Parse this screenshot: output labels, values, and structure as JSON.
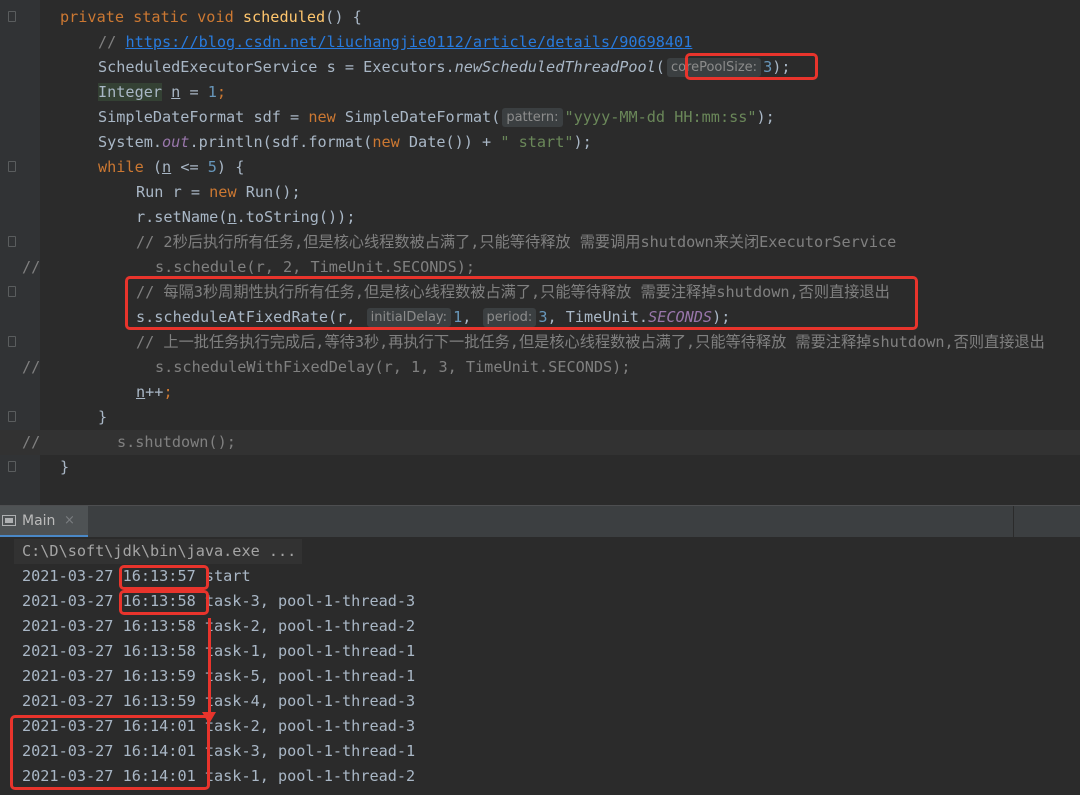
{
  "editor": {
    "lines": [
      {
        "segs": [
          [
            "kw",
            "private static void "
          ],
          [
            "fn",
            "scheduled"
          ],
          [
            "def",
            "() {"
          ]
        ]
      },
      {
        "segs": [
          [
            "cm",
            "// "
          ],
          [
            "url",
            "https://blog.csdn.net/liuchangjie0112/article/details/90698401"
          ]
        ]
      },
      {
        "segs": [
          [
            "def",
            "ScheduledExecutorService s = Executors."
          ],
          [
            "def it",
            "newScheduledThreadPool"
          ],
          [
            "def",
            "("
          ],
          [
            "hint",
            "corePoolSize:"
          ],
          [
            "num",
            "3"
          ],
          [
            "def",
            ");"
          ]
        ]
      },
      {
        "segs": [
          [
            "def hlk",
            "Integer"
          ],
          [
            "def",
            " "
          ],
          [
            "var",
            "n"
          ],
          [
            "def",
            " = "
          ],
          [
            "num",
            "1"
          ],
          [
            "kw",
            ";"
          ]
        ]
      },
      {
        "segs": [
          [
            "def",
            "SimpleDateFormat sdf = "
          ],
          [
            "kw",
            "new "
          ],
          [
            "def",
            "SimpleDateFormat("
          ],
          [
            "hint",
            "pattern:"
          ],
          [
            "str",
            "\"yyyy-MM-dd HH:mm:ss\""
          ],
          [
            "def",
            ");"
          ]
        ]
      },
      {
        "segs": [
          [
            "def",
            "System."
          ],
          [
            "st",
            "out"
          ],
          [
            "def",
            ".println(sdf.format("
          ],
          [
            "kw",
            "new "
          ],
          [
            "def",
            "Date()) + "
          ],
          [
            "str",
            "\" start\""
          ],
          [
            "def",
            ");"
          ]
        ]
      },
      {
        "segs": [
          [
            "kw",
            "while "
          ],
          [
            "def",
            "("
          ],
          [
            "var",
            "n"
          ],
          [
            "def",
            " <= "
          ],
          [
            "num",
            "5"
          ],
          [
            "def",
            ") {"
          ]
        ]
      },
      {
        "segs": [
          [
            "def",
            "Run r = "
          ],
          [
            "kw",
            "new "
          ],
          [
            "def",
            "Run();"
          ]
        ]
      },
      {
        "segs": [
          [
            "def",
            "r.setName("
          ],
          [
            "var",
            "n"
          ],
          [
            "def",
            ".toString());"
          ]
        ]
      },
      {
        "segs": [
          [
            "cm",
            "// 2秒后执行所有任务,但是核心线程数被占满了,只能等待释放 需要调用shutdown来关闭ExecutorService"
          ]
        ]
      },
      {
        "segs": [
          [
            "cm",
            "s.schedule(r, 2, TimeUnit.SECONDS);"
          ]
        ]
      },
      {
        "segs": [
          [
            "cm",
            "// 每隔3秒周期性执行所有任务,但是核心线程数被占满了,只能等待释放 需要注释掉shutdown,否则直接退出"
          ]
        ]
      },
      {
        "segs": [
          [
            "def",
            "s.scheduleAtFixedRate(r, "
          ],
          [
            "hint",
            "initialDelay:"
          ],
          [
            "num",
            "1"
          ],
          [
            "def",
            ", "
          ],
          [
            "hint",
            "period:"
          ],
          [
            "num",
            "3"
          ],
          [
            "def",
            ", TimeUnit."
          ],
          [
            "st",
            "SECONDS"
          ],
          [
            "def",
            ");"
          ]
        ]
      },
      {
        "segs": [
          [
            "cm",
            "// 上一批任务执行完成后,等待3秒,再执行下一批任务,但是核心线程数被占满了,只能等待释放 需要注释掉shutdown,否则直接退出"
          ]
        ]
      },
      {
        "segs": [
          [
            "cm",
            "s.scheduleWithFixedDelay(r, 1, 3, TimeUnit.SECONDS);"
          ]
        ]
      },
      {
        "segs": [
          [
            "var",
            "n"
          ],
          [
            "def",
            "++"
          ],
          [
            "kw",
            ";"
          ]
        ]
      },
      {
        "segs": [
          [
            "def",
            "}"
          ]
        ]
      },
      {
        "segs": [
          [
            "cm",
            "s.shutdown();"
          ]
        ]
      },
      {
        "segs": [
          [
            "def",
            "}"
          ]
        ]
      }
    ],
    "comment_marker": "//"
  },
  "run_panel": {
    "tab_label": "Main",
    "tab_close": "×",
    "lines": [
      "C:\\D\\soft\\jdk\\bin\\java.exe ...",
      "2021-03-27 16:13:57 start",
      "2021-03-27 16:13:58 task-3, pool-1-thread-3",
      "2021-03-27 16:13:58 task-2, pool-1-thread-2",
      "2021-03-27 16:13:58 task-1, pool-1-thread-1",
      "2021-03-27 16:13:59 task-5, pool-1-thread-1",
      "2021-03-27 16:13:59 task-4, pool-1-thread-3",
      "2021-03-27 16:14:01 task-2, pool-1-thread-3",
      "2021-03-27 16:14:01 task-3, pool-1-thread-1",
      "2021-03-27 16:14:01 task-1, pool-1-thread-2"
    ]
  },
  "colors": {
    "background": "#2b2b2b",
    "keyword": "#cc7832",
    "method": "#ffc66d",
    "comment": "#808080",
    "number": "#6897bb",
    "string": "#6a8759",
    "static_field": "#9876aa",
    "annotation_box": "#e8342c"
  }
}
